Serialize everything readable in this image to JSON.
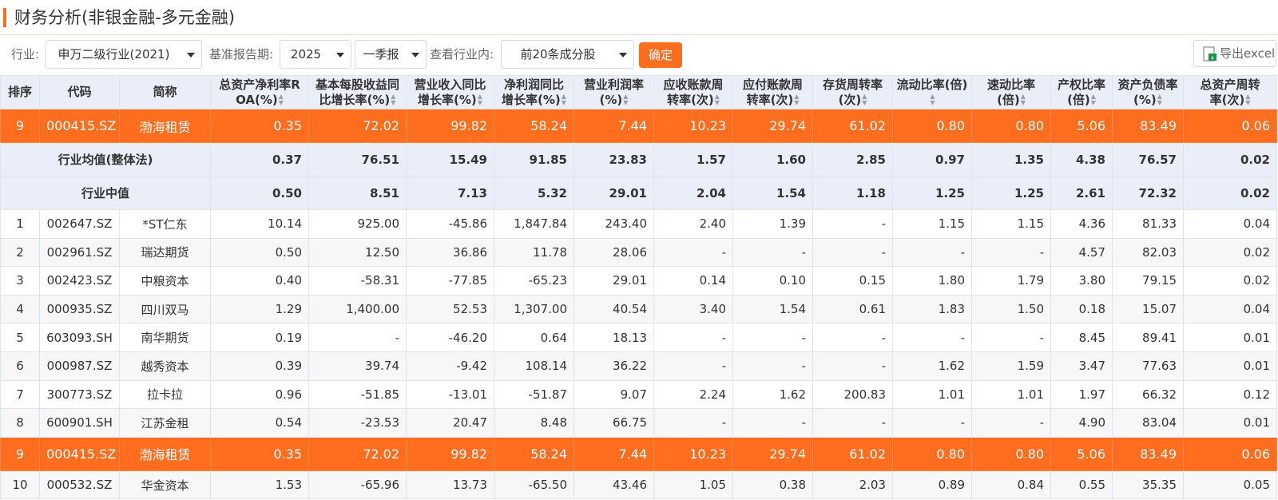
{
  "page": {
    "title": "财务分析(非银金融-多元金融)"
  },
  "filters": {
    "industry_label": "行业:",
    "industry_value": "申万二级行业(2021)",
    "report_label": "基准报告期:",
    "year_value": "2025",
    "quarter_value": "一季报",
    "scope_label": "查看行业内:",
    "scope_value": "前20条成分股",
    "confirm_label": "确定",
    "export_label": "导出excel"
  },
  "table": {
    "headers": [
      {
        "l1": "排序",
        "l2": "",
        "sort": false
      },
      {
        "l1": "代码",
        "l2": "",
        "sort": false
      },
      {
        "l1": "简称",
        "l2": "",
        "sort": false
      },
      {
        "l1": "总资产净利率R",
        "l2": "OA(%)",
        "sort": true
      },
      {
        "l1": "基本每股收益同",
        "l2": "比增长率(%)",
        "sort": true
      },
      {
        "l1": "营业收入同比",
        "l2": "增长率(%)",
        "sort": true
      },
      {
        "l1": "净利润同比",
        "l2": "增长率(%)",
        "sort": true
      },
      {
        "l1": "营业利润率",
        "l2": "(%)",
        "sort": true
      },
      {
        "l1": "应收账款周",
        "l2": "转率(次)",
        "sort": true
      },
      {
        "l1": "应付账款周",
        "l2": "转率(次)",
        "sort": true
      },
      {
        "l1": "存货周转率",
        "l2": "(次)",
        "sort": true
      },
      {
        "l1": "流动比率(倍)",
        "l2": "",
        "sort": true
      },
      {
        "l1": "速动比率",
        "l2": "(倍)",
        "sort": true
      },
      {
        "l1": "产权比率",
        "l2": "(倍)",
        "sort": true
      },
      {
        "l1": "资产负债率",
        "l2": "(%)",
        "sort": true
      },
      {
        "l1": "总资产周转",
        "l2": "率(次)",
        "sort": true
      }
    ],
    "highlight_row": {
      "rank": "9",
      "code": "000415.SZ",
      "name": "渤海租赁",
      "values": [
        "0.35",
        "72.02",
        "99.82",
        "58.24",
        "7.44",
        "10.23",
        "29.74",
        "61.02",
        "0.80",
        "0.80",
        "5.06",
        "83.49",
        "0.06"
      ]
    },
    "avg_rows": [
      {
        "label": "行业均值(整体法)",
        "values": [
          "0.37",
          "76.51",
          "15.49",
          "91.85",
          "23.83",
          "1.57",
          "1.60",
          "2.85",
          "0.97",
          "1.35",
          "4.38",
          "76.57",
          "0.02"
        ]
      },
      {
        "label": "行业中值",
        "values": [
          "0.50",
          "8.51",
          "7.13",
          "5.32",
          "29.01",
          "2.04",
          "1.54",
          "1.18",
          "1.25",
          "1.25",
          "2.61",
          "72.32",
          "0.02"
        ]
      }
    ],
    "rows": [
      {
        "rank": "1",
        "code": "002647.SZ",
        "name": "*ST仁东",
        "values": [
          "10.14",
          "925.00",
          "-45.86",
          "1,847.84",
          "243.40",
          "2.40",
          "1.39",
          "-",
          "1.15",
          "1.15",
          "4.36",
          "81.33",
          "0.04"
        ]
      },
      {
        "rank": "2",
        "code": "002961.SZ",
        "name": "瑞达期货",
        "values": [
          "0.50",
          "12.50",
          "36.86",
          "11.78",
          "28.06",
          "-",
          "-",
          "-",
          "-",
          "-",
          "4.57",
          "82.03",
          "0.02"
        ]
      },
      {
        "rank": "3",
        "code": "002423.SZ",
        "name": "中粮资本",
        "values": [
          "0.40",
          "-58.31",
          "-77.85",
          "-65.23",
          "29.01",
          "0.14",
          "0.10",
          "0.15",
          "1.80",
          "1.79",
          "3.80",
          "79.15",
          "0.02"
        ]
      },
      {
        "rank": "4",
        "code": "000935.SZ",
        "name": "四川双马",
        "values": [
          "1.29",
          "1,400.00",
          "52.53",
          "1,307.00",
          "40.54",
          "3.40",
          "1.54",
          "0.61",
          "1.83",
          "1.50",
          "0.18",
          "15.07",
          "0.04"
        ]
      },
      {
        "rank": "5",
        "code": "603093.SH",
        "name": "南华期货",
        "values": [
          "0.19",
          "-",
          "-46.20",
          "0.64",
          "18.13",
          "-",
          "-",
          "-",
          "-",
          "-",
          "8.45",
          "89.41",
          "0.01"
        ]
      },
      {
        "rank": "6",
        "code": "000987.SZ",
        "name": "越秀资本",
        "values": [
          "0.39",
          "39.74",
          "-9.42",
          "108.14",
          "36.22",
          "-",
          "-",
          "-",
          "1.62",
          "1.59",
          "3.47",
          "77.63",
          "0.01"
        ]
      },
      {
        "rank": "7",
        "code": "300773.SZ",
        "name": "拉卡拉",
        "values": [
          "0.96",
          "-51.85",
          "-13.01",
          "-51.87",
          "9.07",
          "2.24",
          "1.62",
          "200.83",
          "1.01",
          "1.01",
          "1.97",
          "66.32",
          "0.12"
        ]
      },
      {
        "rank": "8",
        "code": "600901.SH",
        "name": "江苏金租",
        "values": [
          "0.54",
          "-23.53",
          "20.47",
          "8.48",
          "66.75",
          "-",
          "-",
          "-",
          "-",
          "-",
          "4.90",
          "83.04",
          "0.01"
        ]
      },
      {
        "rank": "9",
        "code": "000415.SZ",
        "name": "渤海租赁",
        "values": [
          "0.35",
          "72.02",
          "99.82",
          "58.24",
          "7.44",
          "10.23",
          "29.74",
          "61.02",
          "0.80",
          "0.80",
          "5.06",
          "83.49",
          "0.06"
        ],
        "highlight": true
      },
      {
        "rank": "10",
        "code": "000532.SZ",
        "name": "华金资本",
        "values": [
          "1.53",
          "-65.96",
          "13.73",
          "-65.50",
          "43.46",
          "1.05",
          "0.38",
          "2.03",
          "0.89",
          "0.84",
          "0.55",
          "35.35",
          "0.05"
        ]
      }
    ]
  },
  "colors": {
    "accent": "#ff6d1f",
    "header_bg": "#e9eef8",
    "code_link": "#1b4e9c"
  }
}
